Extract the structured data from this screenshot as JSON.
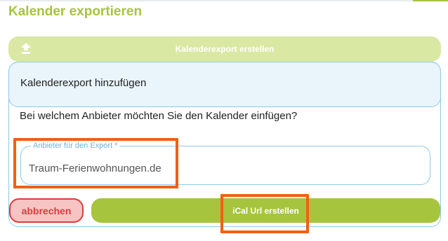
{
  "page": {
    "title": "Kalender exportieren"
  },
  "header_bar": {
    "label": "Kalenderexport erstellen",
    "icon": "upload-icon"
  },
  "panel": {
    "title": "Kalenderexport hinzufügen",
    "question": "Bei welchem Anbieter möchten Sie den Kalender einfügen?"
  },
  "provider_field": {
    "label": "Anbieter für den Export *",
    "value": "Traum-Ferienwohnungen.de"
  },
  "actions": {
    "cancel_label": "abbrechen",
    "create_label": "iCal Url erstellen"
  },
  "colors": {
    "brand_green": "#a6c43e",
    "light_green": "#d9e8a3",
    "panel_border": "#8ec8e8",
    "cancel_red": "#e13a3a",
    "highlight_orange": "#f06012"
  }
}
